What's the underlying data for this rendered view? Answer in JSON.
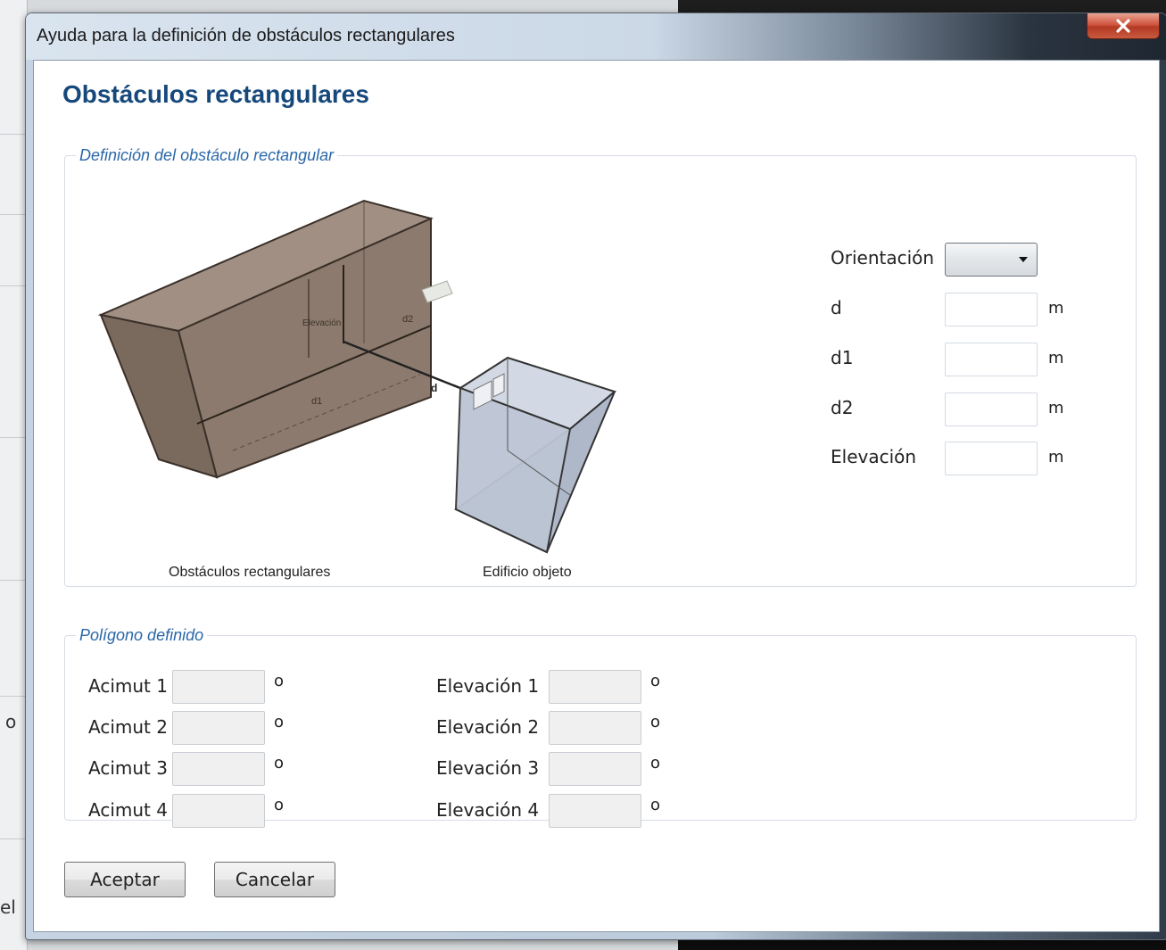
{
  "window": {
    "title": "Ayuda para la definición de obstáculos rectangulares"
  },
  "page": {
    "heading": "Obstáculos rectangulares"
  },
  "definition_group": {
    "legend": "Definición del obstáculo rectangular",
    "illustration": {
      "labels": {
        "elevacion": "Elevación",
        "d1": "d1",
        "d2": "d2",
        "d": "d"
      },
      "caption_obstacle": "Obstáculos rectangulares",
      "caption_building": "Edificio objeto"
    },
    "fields": {
      "orientacion_label": "Orientación",
      "orientacion_value": "",
      "d_label": "d",
      "d_value": "",
      "d_unit": "m",
      "d1_label": "d1",
      "d1_value": "",
      "d1_unit": "m",
      "d2_label": "d2",
      "d2_value": "",
      "d2_unit": "m",
      "elevacion_label": "Elevación",
      "elevacion_value": "",
      "elevacion_unit": "m"
    }
  },
  "polygon_group": {
    "legend": "Polígono definido",
    "acimut": [
      {
        "label": "Acimut 1",
        "value": "",
        "unit": "o"
      },
      {
        "label": "Acimut 2",
        "value": "",
        "unit": "o"
      },
      {
        "label": "Acimut 3",
        "value": "",
        "unit": "o"
      },
      {
        "label": "Acimut 4",
        "value": "",
        "unit": "o"
      }
    ],
    "elevacion": [
      {
        "label": "Elevación 1",
        "value": "",
        "unit": "o"
      },
      {
        "label": "Elevación 2",
        "value": "",
        "unit": "o"
      },
      {
        "label": "Elevación 3",
        "value": "",
        "unit": "o"
      },
      {
        "label": "Elevación 4",
        "value": "",
        "unit": "o"
      }
    ]
  },
  "buttons": {
    "accept": "Aceptar",
    "cancel": "Cancelar"
  },
  "background": {
    "fragment_1": "o",
    "fragment_2": "el"
  },
  "colors": {
    "heading": "#16487c",
    "legend": "#2a67a8",
    "close_button": "#c8452f",
    "obstacle_fill": "#8b7a6d",
    "building_fill": "#b8c2d2"
  },
  "icons": {
    "close": "close-icon",
    "dropdown": "chevron-down-icon"
  }
}
